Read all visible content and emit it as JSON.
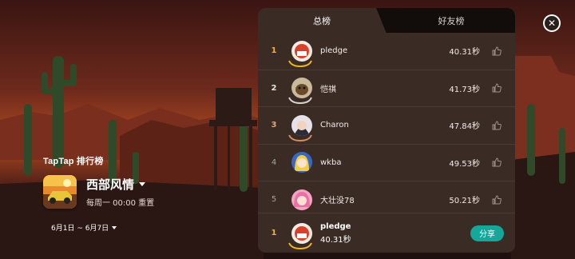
{
  "colors": {
    "panel_bg": "#3a2c25",
    "inactive_tab_bg": "#120d0b",
    "gold": "#f2b51b",
    "share_button": "#15a79a"
  },
  "brand": {
    "label": "TapTap 排行榜"
  },
  "game": {
    "title": "西部风情",
    "reset_text": "每周一 00:00 重置",
    "date_range": "6月1日 ~ 6月7日"
  },
  "tabs": [
    {
      "label": "总榜",
      "active": true
    },
    {
      "label": "好友榜",
      "active": false
    }
  ],
  "leaderboard": [
    {
      "rank": "1",
      "name": "pledge",
      "time": "40.31秒",
      "avatar_icon": "cake-avatar-icon"
    },
    {
      "rank": "2",
      "name": "恺祺",
      "time": "41.73秒",
      "avatar_icon": "dog-avatar-icon"
    },
    {
      "rank": "3",
      "name": "Charon",
      "time": "47.84秒",
      "avatar_icon": "anime-girl-avatar-icon"
    },
    {
      "rank": "4",
      "name": "wkba",
      "time": "49.53秒",
      "avatar_icon": "blonde-girl-avatar-icon"
    },
    {
      "rank": "5",
      "name": "大壮没78",
      "time": "50.21秒",
      "avatar_icon": "pink-hair-avatar-icon"
    }
  ],
  "my_entry": {
    "rank": "1",
    "name": "pledge",
    "time": "40.31秒",
    "share_label": "分享"
  },
  "close_icon": "close-icon",
  "like_icon": "thumbs-up-icon"
}
